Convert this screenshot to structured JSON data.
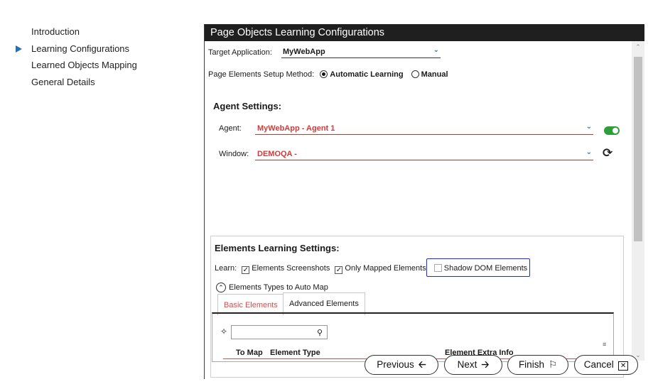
{
  "nav": {
    "items": [
      {
        "label": "Introduction",
        "active": false
      },
      {
        "label": "Learning Configurations",
        "active": true
      },
      {
        "label": "Learned Objects Mapping",
        "active": false
      },
      {
        "label": "General Details",
        "active": false
      }
    ]
  },
  "panel": {
    "title": "Page Objects Learning Configurations",
    "target_app": {
      "label": "Target Application:",
      "value": "MyWebApp"
    },
    "setup_method": {
      "label": "Page Elements Setup Method:",
      "options": [
        {
          "label": "Automatic Learning",
          "selected": true
        },
        {
          "label": "Manual",
          "selected": false
        }
      ]
    },
    "agent_settings": {
      "title": "Agent Settings:",
      "agent": {
        "label": "Agent:",
        "value": "MyWebApp - Agent 1",
        "status_color": "#2e9e3a"
      },
      "window": {
        "label": "Window:",
        "value": "DEMOQA -"
      }
    },
    "elements_learning": {
      "title": "Elements Learning Settings:",
      "learn_label": "Learn:",
      "options": [
        {
          "label": "Elements Screenshots",
          "checked": true
        },
        {
          "label": "Only Mapped Elements",
          "checked": true
        },
        {
          "label": "Shadow DOM Elements",
          "checked": false
        }
      ],
      "auto_map_label": "Elements Types to Auto Map",
      "tabs": [
        {
          "label": "Basic Elements",
          "active": true
        },
        {
          "label": "Advanced Elements",
          "active": false
        }
      ],
      "search": {
        "placeholder": ""
      },
      "grid_headers": {
        "to_map": "To Map",
        "element_type": "Element Type",
        "extra_info": "Element Extra Info"
      }
    }
  },
  "footer": {
    "previous": "Previous",
    "next": "Next",
    "finish": "Finish",
    "cancel": "Cancel"
  },
  "colors": {
    "accent": "#2a6fb0",
    "required": "#d23a3a",
    "annotation": "#1d2ec9"
  }
}
